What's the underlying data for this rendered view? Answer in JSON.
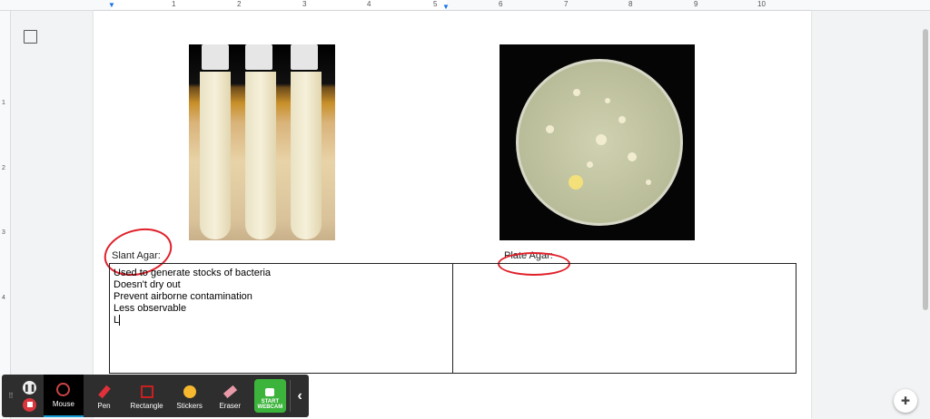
{
  "ruler": {
    "ticks": [
      "1",
      "2",
      "3",
      "4",
      "5",
      "6",
      "7",
      "8",
      "9",
      "10"
    ],
    "vticks": [
      "1",
      "2",
      "3",
      "4"
    ]
  },
  "doc": {
    "slant_label": "Slant Agar:",
    "plate_label": "Plate Agar:",
    "slant_notes": [
      "Used to generate stocks of bacteria",
      "Doesn't dry out",
      "Prevent airborne contamination",
      "Less observable",
      "L"
    ],
    "plate_notes": ""
  },
  "toolbar": {
    "mouse": "Mouse",
    "pen": "Pen",
    "rectangle": "Rectangle",
    "stickers": "Stickers",
    "eraser": "Eraser",
    "webcam_line1": "START",
    "webcam_line2": "WEBCAM"
  },
  "colors": {
    "annotation": "#e0202a",
    "webcam": "#3cb43c",
    "active_tab": "#1a9bd8"
  }
}
